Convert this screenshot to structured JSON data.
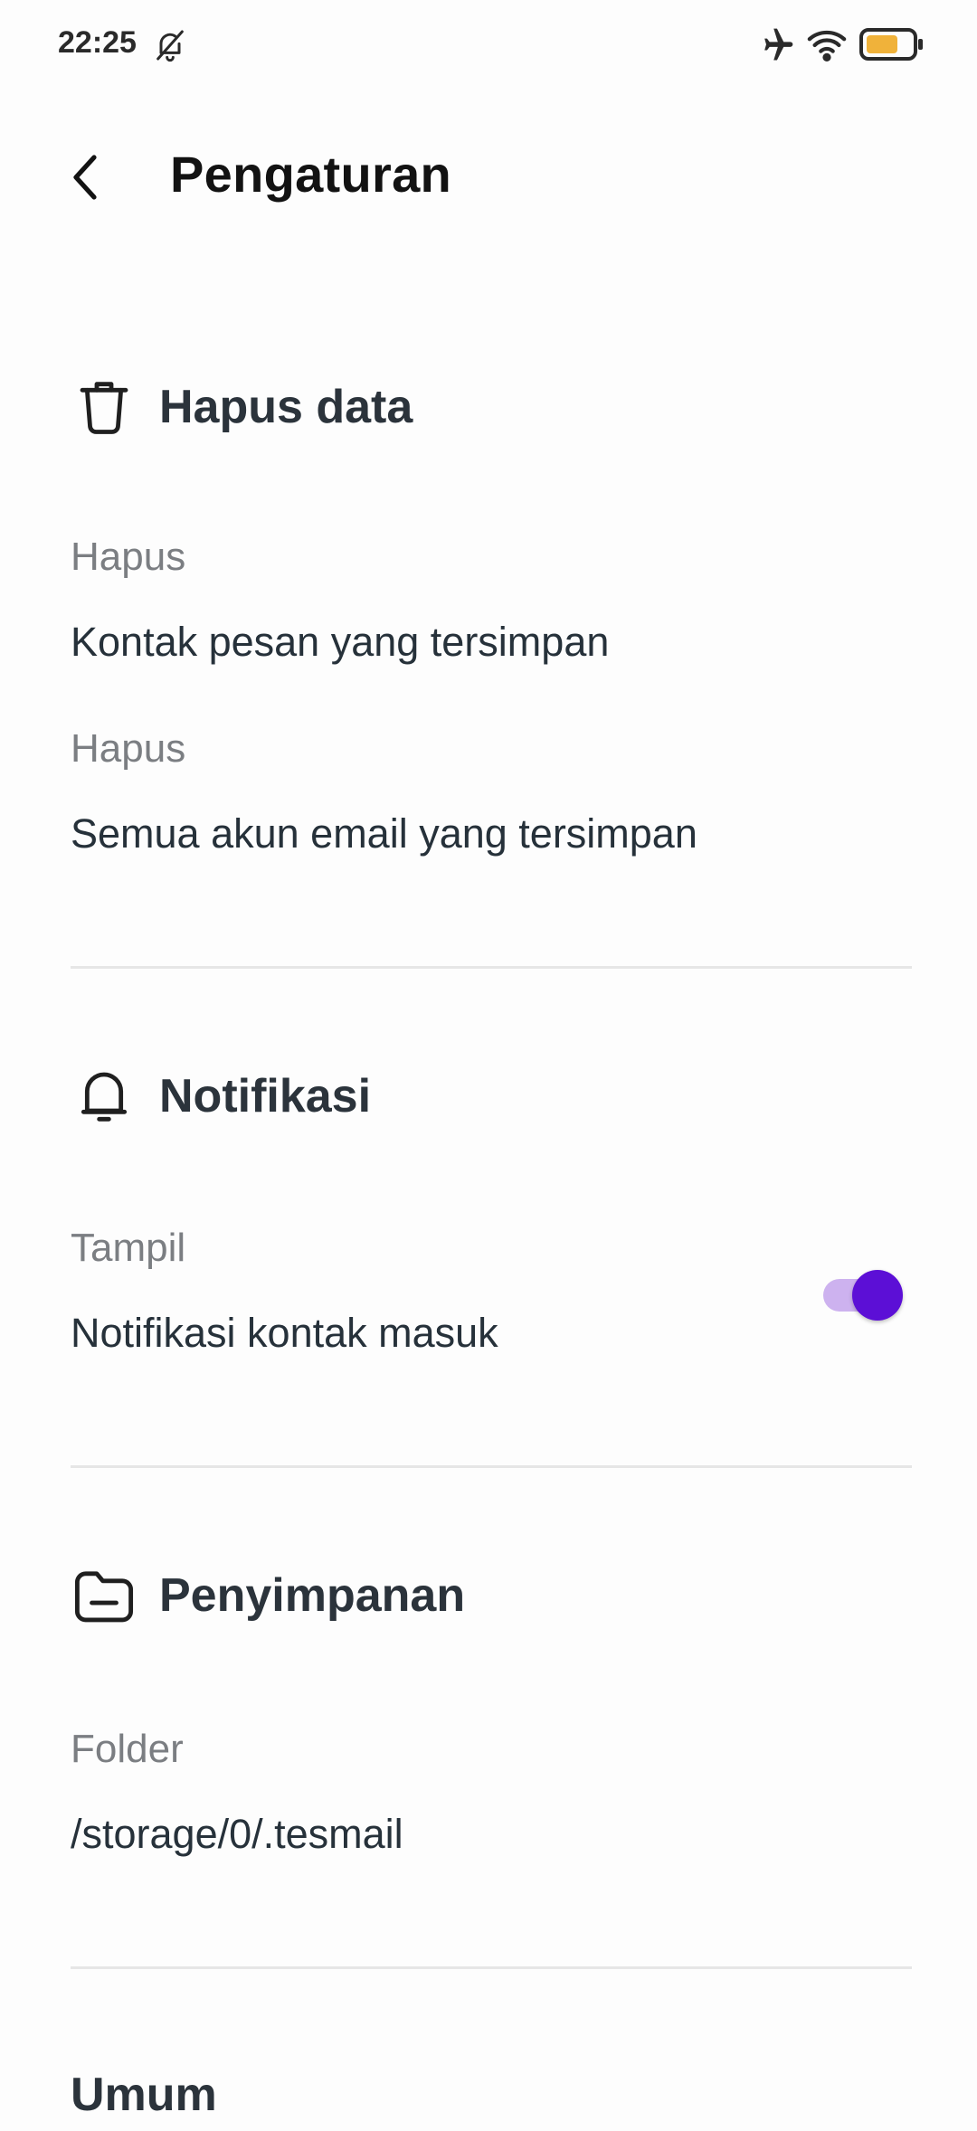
{
  "status_bar": {
    "time": "22:25",
    "icons": [
      "bell-off-icon",
      "airplane-icon",
      "wifi-icon",
      "battery-icon"
    ],
    "battery_color": "#f0b23a"
  },
  "header": {
    "title": "Pengaturan",
    "back_icon": "chevron-left-icon"
  },
  "sections": {
    "delete_data": {
      "title": "Hapus data",
      "icon": "trash-icon",
      "items": [
        {
          "label": "Hapus",
          "value": "Kontak pesan yang tersimpan"
        },
        {
          "label": "Hapus",
          "value": "Semua akun email yang tersimpan"
        }
      ]
    },
    "notifications": {
      "title": "Notifikasi",
      "icon": "bell-icon",
      "items": [
        {
          "label": "Tampil",
          "value": "Notifikasi kontak masuk",
          "toggle_on": true
        }
      ]
    },
    "storage": {
      "title": "Penyimpanan",
      "icon": "folder-icon",
      "items": [
        {
          "label": "Folder",
          "value": "/storage/0/.tesmail"
        }
      ]
    },
    "general": {
      "title": "Umum"
    }
  },
  "colors": {
    "accent": "#5c0fd6",
    "toggle_track": "#cdb2ef",
    "text_primary": "#2b333b",
    "text_secondary": "#7b7e82"
  }
}
